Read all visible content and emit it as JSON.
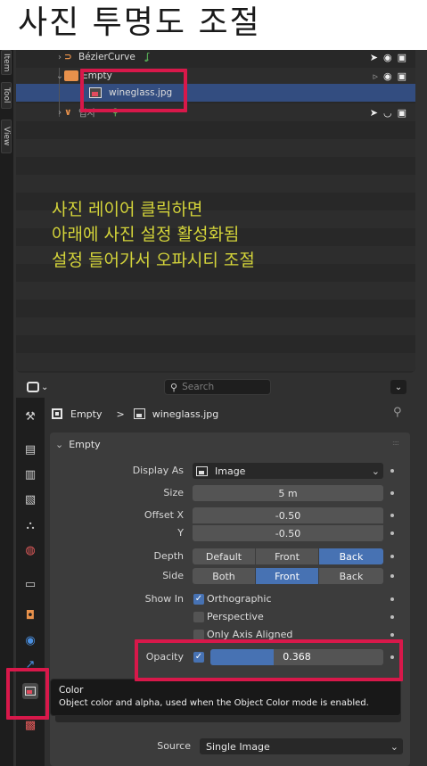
{
  "headline": "사진 투명도 조절",
  "side_tabs": [
    "Item",
    "Tool",
    "View"
  ],
  "outliner": {
    "rows": [
      {
        "label": "BézierCurve",
        "icon": "curve-icon",
        "tail_icon": "curve-data-icon"
      },
      {
        "label": "Empty",
        "icon": "empty-icon"
      },
      {
        "label": "wineglass.jpg",
        "icon": "image-icon"
      },
      {
        "label": "입자",
        "icon": "particle-icon"
      }
    ]
  },
  "annotation": {
    "line1": "사진 레이어 클릭하면",
    "line2": "아래에 사진 설정 활성화됨",
    "line3": "설정 들어가서 오파시티 조절"
  },
  "header": {
    "search_placeholder": "Search"
  },
  "breadcrumb": {
    "object": "Empty",
    "separator": ">",
    "data": "wineglass.jpg"
  },
  "panel": {
    "title": "Empty",
    "display_as_label": "Display As",
    "display_as_value": "Image",
    "size_label": "Size",
    "size_value": "5 m",
    "offset_x_label": "Offset X",
    "offset_x_value": "-0.50",
    "offset_y_label": "Y",
    "offset_y_value": "-0.50",
    "depth_label": "Depth",
    "depth_options": [
      "Default",
      "Front",
      "Back"
    ],
    "depth_selected": "Back",
    "side_label": "Side",
    "side_options": [
      "Both",
      "Front",
      "Back"
    ],
    "side_selected": "Front",
    "show_in_label": "Show In",
    "show_in": [
      {
        "label": "Orthographic",
        "checked": true
      },
      {
        "label": "Perspective",
        "checked": false
      },
      {
        "label": "Only Axis Aligned",
        "checked": false
      }
    ],
    "opacity_label": "Opacity",
    "opacity_value": "0.368",
    "opacity_fraction": 0.368,
    "source_label": "Source",
    "source_value": "Single Image"
  },
  "tooltip": {
    "title": "Color",
    "body": "Object color and alpha, used when the Object Color mode is enabled."
  },
  "colors": {
    "highlight": "#d8184a",
    "accent": "#4772b3",
    "annotation": "#d4d43a"
  }
}
